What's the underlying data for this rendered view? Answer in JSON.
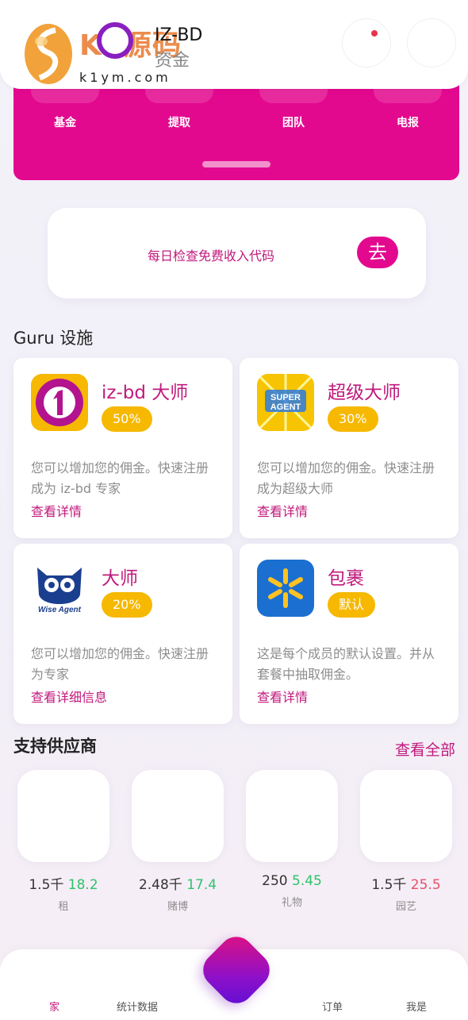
{
  "header": {
    "watermark_text": "K1源码",
    "watermark_sub": "k1ym.com",
    "app_title": "IZ-BD",
    "app_subtitle": "资金"
  },
  "quick_actions": [
    {
      "label": "基金"
    },
    {
      "label": "提取"
    },
    {
      "label": "团队"
    },
    {
      "label": "电报"
    }
  ],
  "daily_code": {
    "text": "每日检查免费收入代码",
    "button": "去"
  },
  "guru_section": {
    "title": "Guru 设施",
    "cards": [
      {
        "name": "iz-bd 大师",
        "badge": "50%",
        "desc": "您可以增加您的佣金。快速注册成为 iz-bd 专家",
        "link": "查看详情",
        "icon": "iz-bd-logo-icon"
      },
      {
        "name": "超级大师",
        "badge": "30%",
        "desc": "您可以增加您的佣金。快速注册成为超级大师",
        "link": "查看详情",
        "icon": "super-agent-icon"
      },
      {
        "name": "大师",
        "badge": "20%",
        "desc": "您可以增加您的佣金。快速注册为专家",
        "link": "查看详细信息",
        "icon": "wise-agent-owl-icon"
      },
      {
        "name": "包裹",
        "badge": "默认",
        "desc": "这是每个成员的默认设置。并从套餐中抽取佣金。",
        "link": "查看详情",
        "icon": "spark-icon"
      }
    ]
  },
  "suppliers": {
    "title": "支持供应商",
    "view_all": "查看全部",
    "items": [
      {
        "amount": "1.5千",
        "change": "18.2",
        "trend": "up",
        "category": "租"
      },
      {
        "amount": "2.48千",
        "change": "17.4",
        "trend": "up",
        "category": "赌博"
      },
      {
        "amount": "250",
        "change": "5.45",
        "trend": "up",
        "category": "礼物"
      },
      {
        "amount": "1.5千",
        "change": "25.5",
        "trend": "down",
        "category": "园艺"
      }
    ]
  },
  "icon_labels": {
    "super_top": "SUPER",
    "super_bottom": "AGENT",
    "wise": "Wise Agent"
  },
  "nav": {
    "home": "家",
    "stats": "统计数据",
    "orders": "订单",
    "me": "我是"
  },
  "colors": {
    "primary": "#e3098f",
    "accent_text": "#c1197c",
    "badge": "#f6b800",
    "up": "#2dc36a",
    "down": "#e8506a"
  }
}
